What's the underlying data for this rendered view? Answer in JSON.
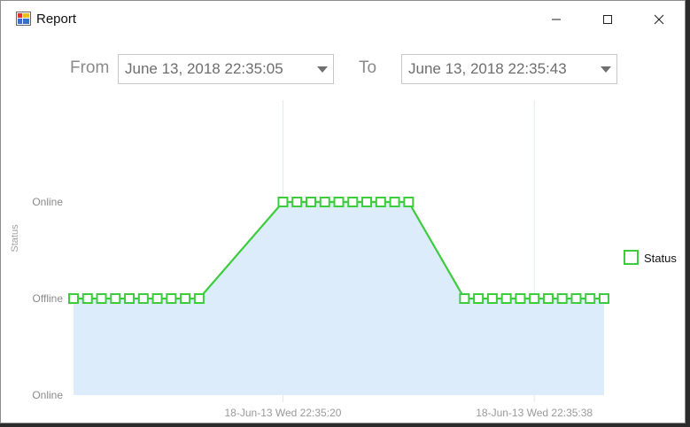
{
  "window": {
    "title": "Report",
    "icon": "report-app-icon",
    "controls": [
      "minimize-icon",
      "maximize-icon",
      "close-icon"
    ]
  },
  "filters": {
    "from_label": "From",
    "from_value": "June 13, 2018 22:35:05",
    "to_label": "To",
    "to_value": "June 13, 2018 22:35:43"
  },
  "chart_data": {
    "type": "area",
    "ylabel": "Status",
    "y_ticks": [
      "Online",
      "Offline",
      "Online"
    ],
    "x_ticks": [
      "18-Jun-13 Wed 22:35:20",
      "18-Jun-13 Wed 22:35:38"
    ],
    "ylim": [
      0,
      2
    ],
    "grid": "vertical",
    "legend_position": "right",
    "series": [
      {
        "name": "Status",
        "color": "#3ccc3c",
        "fill": "#dcecfb",
        "marker": "hollow-square",
        "x": [
          "22:35:05",
          "22:35:06",
          "22:35:07",
          "22:35:08",
          "22:35:09",
          "22:35:10",
          "22:35:11",
          "22:35:12",
          "22:35:13",
          "22:35:14",
          "22:35:20",
          "22:35:21",
          "22:35:22",
          "22:35:23",
          "22:35:24",
          "22:35:25",
          "22:35:26",
          "22:35:27",
          "22:35:28",
          "22:35:29",
          "22:35:33",
          "22:35:34",
          "22:35:35",
          "22:35:36",
          "22:35:37",
          "22:35:38",
          "22:35:39",
          "22:35:40",
          "22:35:41",
          "22:35:42",
          "22:35:43"
        ],
        "values": [
          1,
          1,
          1,
          1,
          1,
          1,
          1,
          1,
          1,
          1,
          2,
          2,
          2,
          2,
          2,
          2,
          2,
          2,
          2,
          2,
          1,
          1,
          1,
          1,
          1,
          1,
          1,
          1,
          1,
          1,
          1
        ]
      }
    ]
  }
}
